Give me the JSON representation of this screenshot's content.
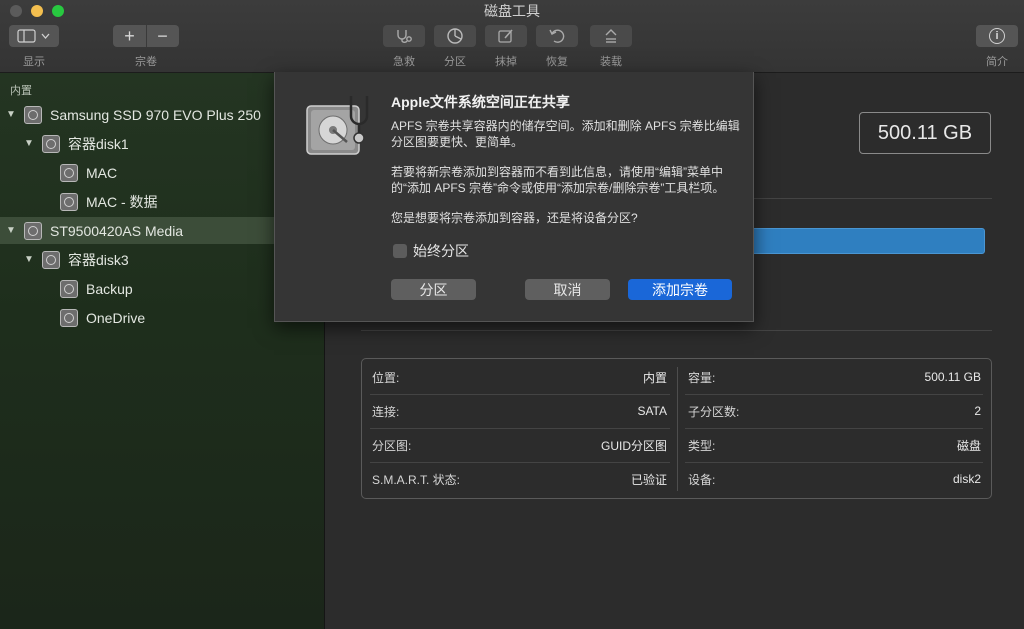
{
  "window": {
    "title": "磁盘工具"
  },
  "toolbar": {
    "view_label": "显示",
    "volume_label": "宗卷",
    "firstaid_label": "急救",
    "partition_label": "分区",
    "erase_label": "抹掉",
    "restore_label": "恢复",
    "mount_label": "装载",
    "info_label": "简介",
    "add_glyph": "+",
    "remove_glyph": "−",
    "info_glyph": "i"
  },
  "sidebar": {
    "section": "内置",
    "items": [
      {
        "label": "Samsung SSD 970 EVO Plus 250",
        "level": 0,
        "expanded": true,
        "selected": false
      },
      {
        "label": "容器disk1",
        "level": 1,
        "expanded": true,
        "selected": false
      },
      {
        "label": "MAC",
        "level": 2,
        "selected": false
      },
      {
        "label": "MAC - 数据",
        "level": 2,
        "selected": false
      },
      {
        "label": "ST9500420AS Media",
        "level": 0,
        "expanded": true,
        "selected": true
      },
      {
        "label": "容器disk3",
        "level": 1,
        "expanded": true,
        "selected": false
      },
      {
        "label": "Backup",
        "level": 2,
        "selected": false
      },
      {
        "label": "OneDrive",
        "level": 2,
        "selected": false
      }
    ]
  },
  "main": {
    "capacity": "500.11 GB",
    "info": {
      "left": [
        {
          "k": "位置:",
          "v": "内置"
        },
        {
          "k": "连接:",
          "v": "SATA"
        },
        {
          "k": "分区图:",
          "v": "GUID分区图"
        },
        {
          "k": "S.M.A.R.T. 状态:",
          "v": "已验证"
        }
      ],
      "right": [
        {
          "k": "容量:",
          "v": "500.11 GB"
        },
        {
          "k": "子分区数:",
          "v": "2"
        },
        {
          "k": "类型:",
          "v": "磁盘"
        },
        {
          "k": "设备:",
          "v": "disk2"
        }
      ]
    }
  },
  "dialog": {
    "title": "Apple文件系统空间正在共享",
    "para1": "APFS 宗卷共享容器内的储存空间。添加和删除 APFS 宗卷比编辑分区图要更快、更简单。",
    "para2": "若要将新宗卷添加到容器而不看到此信息，请使用“编辑”菜单中的“添加 APFS 宗卷”命令或使用“添加宗卷/删除宗卷”工具栏项。",
    "question": "您是想要将宗卷添加到容器，还是将设备分区?",
    "checkbox_label": "始终分区",
    "checkbox_checked": false,
    "btn_partition": "分区",
    "btn_cancel": "取消",
    "btn_add": "添加宗卷"
  },
  "colors": {
    "accent": "#1a67d8",
    "usage_bar": "#2f7fc0"
  }
}
